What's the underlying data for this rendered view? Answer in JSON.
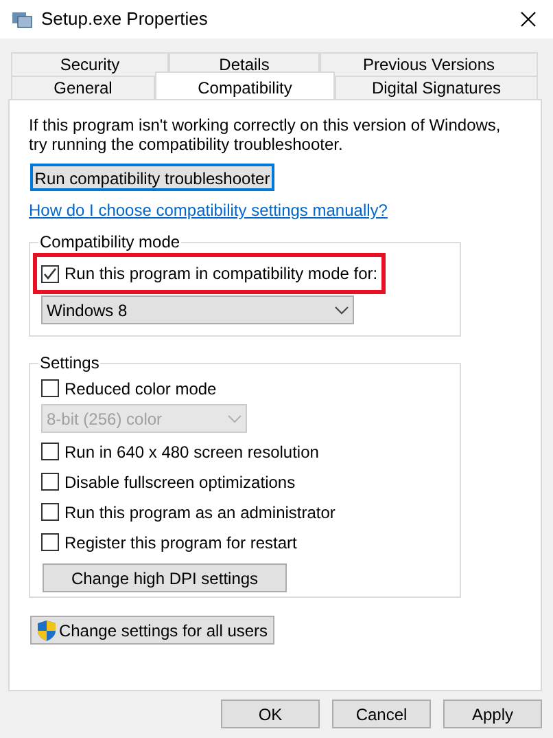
{
  "window": {
    "title": "Setup.exe Properties"
  },
  "tab_rows": [
    {
      "tabs": [
        {
          "label": "Security",
          "selected": false
        },
        {
          "label": "Details",
          "selected": false
        },
        {
          "label": "Previous Versions",
          "selected": false
        }
      ]
    },
    {
      "tabs": [
        {
          "label": "General",
          "selected": false
        },
        {
          "label": "Compatibility",
          "selected": true
        },
        {
          "label": "Digital Signatures",
          "selected": false
        }
      ]
    }
  ],
  "intro": [
    "If this program isn't working correctly on this version of Windows,",
    "try running the compatibility troubleshooter."
  ],
  "troubleshoot_button": {
    "label": "Run compatibility troubleshooter"
  },
  "help_link": "How do I choose compatibility settings manually?",
  "compatibility_mode": {
    "title": "Compatibility mode",
    "checkbox": {
      "label": "Run this program in compatibility mode for:",
      "checked": true,
      "highlighted": true
    },
    "dropdown": {
      "value": "Windows 8",
      "disabled": false
    }
  },
  "settings": {
    "title": "Settings",
    "items": [
      {
        "kind": "checkbox",
        "label": "Reduced color mode",
        "checked": false
      },
      {
        "kind": "dropdown",
        "value": "8-bit (256) color",
        "disabled": true
      },
      {
        "kind": "checkbox",
        "label": "Run in 640 x 480 screen resolution",
        "checked": false
      },
      {
        "kind": "checkbox",
        "label": "Disable fullscreen optimizations",
        "checked": false
      },
      {
        "kind": "checkbox",
        "label": "Run this program as an administrator",
        "checked": false
      },
      {
        "kind": "checkbox",
        "label": "Register this program for restart",
        "checked": false
      },
      {
        "kind": "button",
        "label": "Change high DPI settings"
      }
    ]
  },
  "all_users_button": {
    "label": "Change settings for all users"
  },
  "buttons": [
    "OK",
    "Cancel",
    "Apply"
  ]
}
